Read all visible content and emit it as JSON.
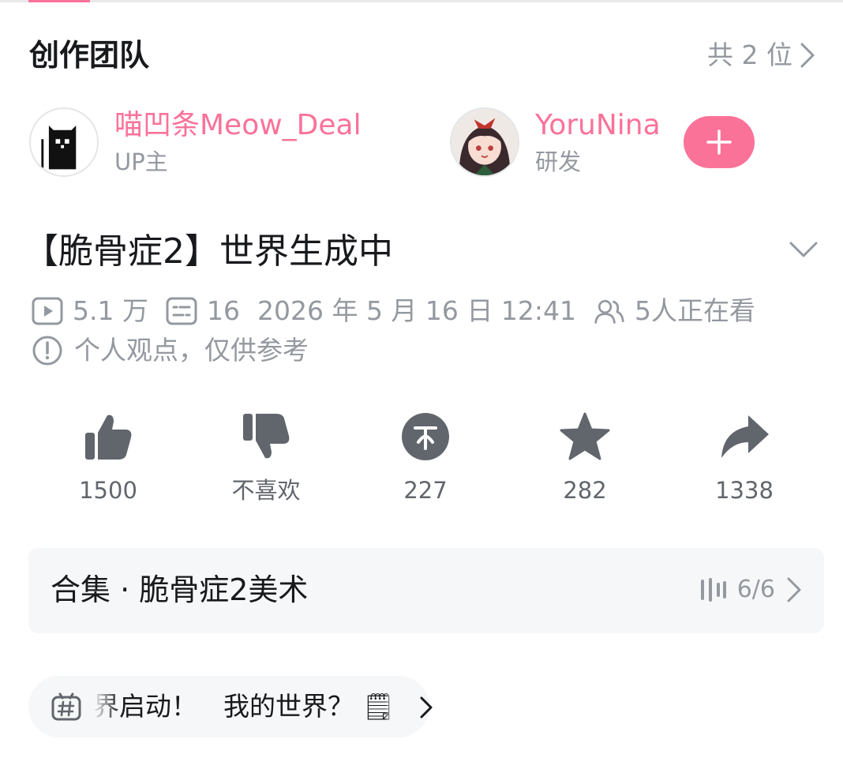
{
  "team": {
    "title": "创作团队",
    "count_label": "共 2 位",
    "members": [
      {
        "name": "喵凹条Meow_Deal",
        "role": "UP主"
      },
      {
        "name": "YoruNina",
        "role": "研发"
      }
    ]
  },
  "video": {
    "title": "【脆骨症2】世界生成中",
    "views": "5.1 万",
    "danmaku": "16",
    "datetime": "2026 年 5 月 16 日 12:41",
    "watching": "5人正在看",
    "notice": "个人观点，仅供参考"
  },
  "actions": [
    {
      "icon": "thumbs-up-icon",
      "label": "1500"
    },
    {
      "icon": "thumbs-down-icon",
      "label": "不喜欢"
    },
    {
      "icon": "coin-icon",
      "label": "227"
    },
    {
      "icon": "star-icon",
      "label": "282"
    },
    {
      "icon": "share-icon",
      "label": "1338"
    }
  ],
  "collection": {
    "title": "合集 · 脆骨症2美术",
    "progress": "6/6"
  },
  "topic": {
    "text": "界启动！　我的世界？ 🗒"
  },
  "colors": {
    "accent": "#fb7299",
    "icon_gray": "#61666d",
    "text_gray": "#9499a0",
    "panel_bg": "#f6f7f8"
  }
}
